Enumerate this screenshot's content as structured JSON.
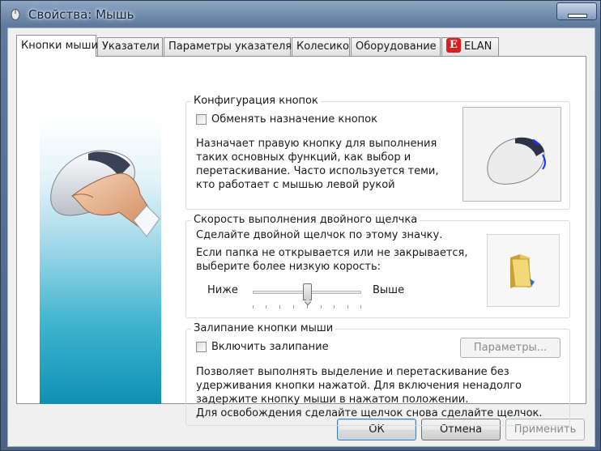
{
  "window": {
    "title": "Свойства: Мышь"
  },
  "tabs": [
    {
      "label": "Кнопки мыши",
      "active": true
    },
    {
      "label": "Указатели"
    },
    {
      "label": "Параметры указателя"
    },
    {
      "label": "Колесико"
    },
    {
      "label": "Оборудование"
    },
    {
      "label": "ELAN",
      "badge": "E"
    }
  ],
  "button_config": {
    "title": "Конфигурация кнопок",
    "swap_label": "Обменять назначение кнопок",
    "swap_checked": false,
    "description_lines": [
      "Назначает правую кнопку для выполнения",
      "таких основных функций, как выбор и",
      "перетаскивание. Часто используется теми,",
      "кто работает с мышью левой рукой"
    ]
  },
  "double_click": {
    "title": "Скорость выполнения двойного щелчка",
    "line1": "Сделайте двойной щелчок по этому значку.",
    "line2": "Если папка не открывается или не закрывается,",
    "line3": "выберите более низкую корость:",
    "slow_label": "Ниже",
    "fast_label": "Выше",
    "speed_fraction": 0.5
  },
  "click_lock": {
    "title": "Залипание кнопки мыши",
    "enable_label": "Включить залипание",
    "enable_checked": false,
    "settings_label": "Параметры...",
    "description_lines": [
      "Позволяет выполнять выделение и перетаскивание без",
      "удерживания кнопки нажатой. Для включения ненадолго",
      "задержите кнопку мыши в нажатом положении.",
      "Для освобождения сделайте щелчок снова сделайте щелчок."
    ]
  },
  "footer": {
    "ok_label": "ОК",
    "cancel_label": "Отмена",
    "apply_label": "Применить"
  },
  "colors": {
    "accent": "#3c7fb1",
    "hero_top": "#e3f3f8",
    "hero_bottom": "#0f90b3",
    "elan_red": "#d52020"
  }
}
